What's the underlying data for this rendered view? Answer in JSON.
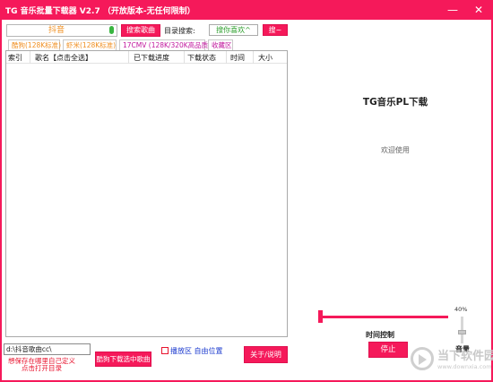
{
  "window": {
    "title": "TG 音乐批量下载器 V2.7 （开放版本-无任何限制）",
    "minimize_glyph": "—",
    "close_glyph": "✕"
  },
  "toolbar": {
    "search_value": "抖音",
    "search_button": "搜索歌曲",
    "dir_label": "目录搜索:",
    "dir_value": "搜你喜欢^",
    "dir_button": "搜~"
  },
  "tabs": [
    {
      "label": "酷狗(128K标准)",
      "color": "#f08f21"
    },
    {
      "label": "虾米(128K标准)",
      "color": "#f08f21"
    },
    {
      "label": "17CMV (128K/320K高品质)",
      "color": "#c0159c"
    },
    {
      "label": "收藏区",
      "color": "#c0159c"
    }
  ],
  "table": {
    "headers": [
      "索引",
      "歌名【点击全选】",
      "已下载进度",
      "下载状态",
      "时间",
      "大小"
    ],
    "rows": []
  },
  "right_panel": {
    "title": "TG音乐PL下载",
    "welcome": "欢迎使用"
  },
  "player": {
    "progress": 0.0,
    "volume_label": "40%",
    "volume": 0.4,
    "time_label": "时间控制",
    "stop_button": "停止",
    "volume_caption": "音量"
  },
  "bottom": {
    "path_value": "d:\\抖音歌曲cc\\",
    "hint_line1": "想保存在哪里自己定义",
    "hint_line2": "点击打开目录",
    "download_button": "酷狗下载选中歌曲",
    "checkbox_label": "播放区 自由位置",
    "about_button": "关于/说明"
  },
  "watermark": {
    "text": "当下软件园",
    "url": "www.downxia.com"
  },
  "colors": {
    "accent": "#f5195a",
    "hint": "#e8132e",
    "link": "#1e3ccf"
  }
}
